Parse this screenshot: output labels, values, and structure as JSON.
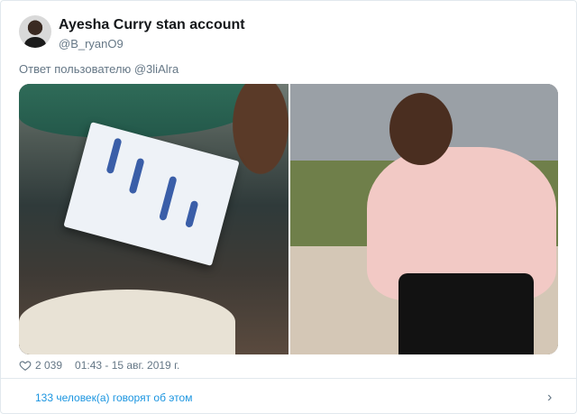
{
  "tweet": {
    "display_name": "Ayesha Curry stan account",
    "handle": "@B_ryanO9",
    "reply_to_label": "Ответ пользователю",
    "reply_to_handle": "@3liAlra",
    "likes": "2 039",
    "timestamp": "01:43 - 15 авг. 2019 г.",
    "discussion": "133 человек(а) говорят об этом"
  },
  "icons": {
    "like": "heart-icon",
    "more": "chevron-right-icon"
  },
  "colors": {
    "link": "#1b95e0",
    "muted": "#657786",
    "border": "#e1e8ed"
  }
}
